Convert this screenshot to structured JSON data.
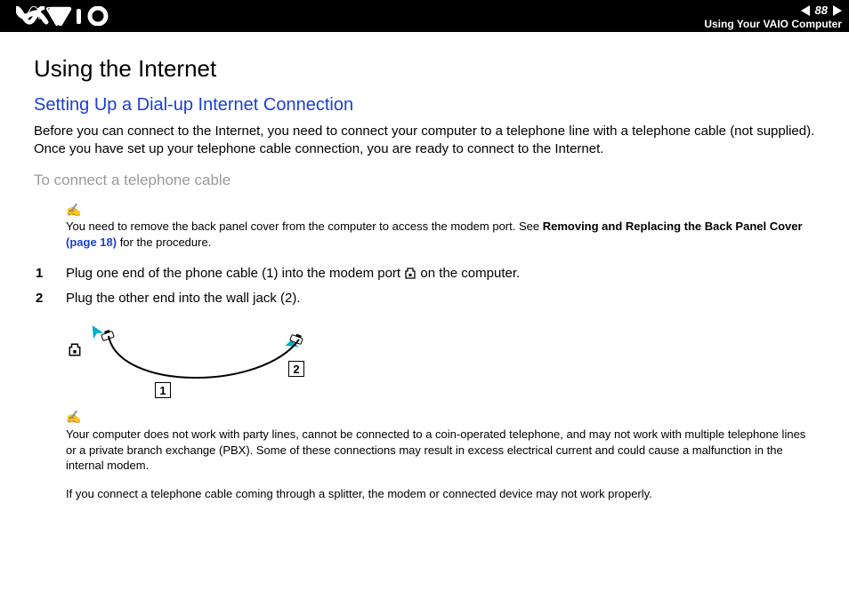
{
  "header": {
    "page_number": "88",
    "breadcrumb": "Using Your VAIO Computer"
  },
  "page": {
    "title": "Using the Internet",
    "subtitle": "Setting Up a Dial-up Internet Connection",
    "intro": "Before you can connect to the Internet, you need to connect your computer to a telephone line with a telephone cable (not supplied). Once you have set up your telephone cable connection, you are ready to connect to the Internet.",
    "section_heading": "To connect a telephone cable",
    "note1_pre": "You need to remove the back panel cover from the computer to access the modem port. See ",
    "note1_bold": "Removing and Replacing the Back Panel Cover ",
    "note1_link": "(page 18)",
    "note1_post": " for the procedure.",
    "steps": [
      {
        "n": "1",
        "text_a": "Plug one end of the phone cable (1) into the modem port ",
        "text_b": " on the computer."
      },
      {
        "n": "2",
        "text_a": "Plug the other end into the wall jack (2).",
        "text_b": ""
      }
    ],
    "diagram": {
      "label1": "1",
      "label2": "2"
    },
    "note2": "Your computer does not work with party lines, cannot be connected to a coin-operated telephone, and may not work with multiple telephone lines or a private branch exchange (PBX). Some of these connections may result in excess electrical current and could cause a malfunction in the internal modem.",
    "note3": "If you connect a telephone cable coming through a splitter, the modem or connected device may not work properly."
  }
}
